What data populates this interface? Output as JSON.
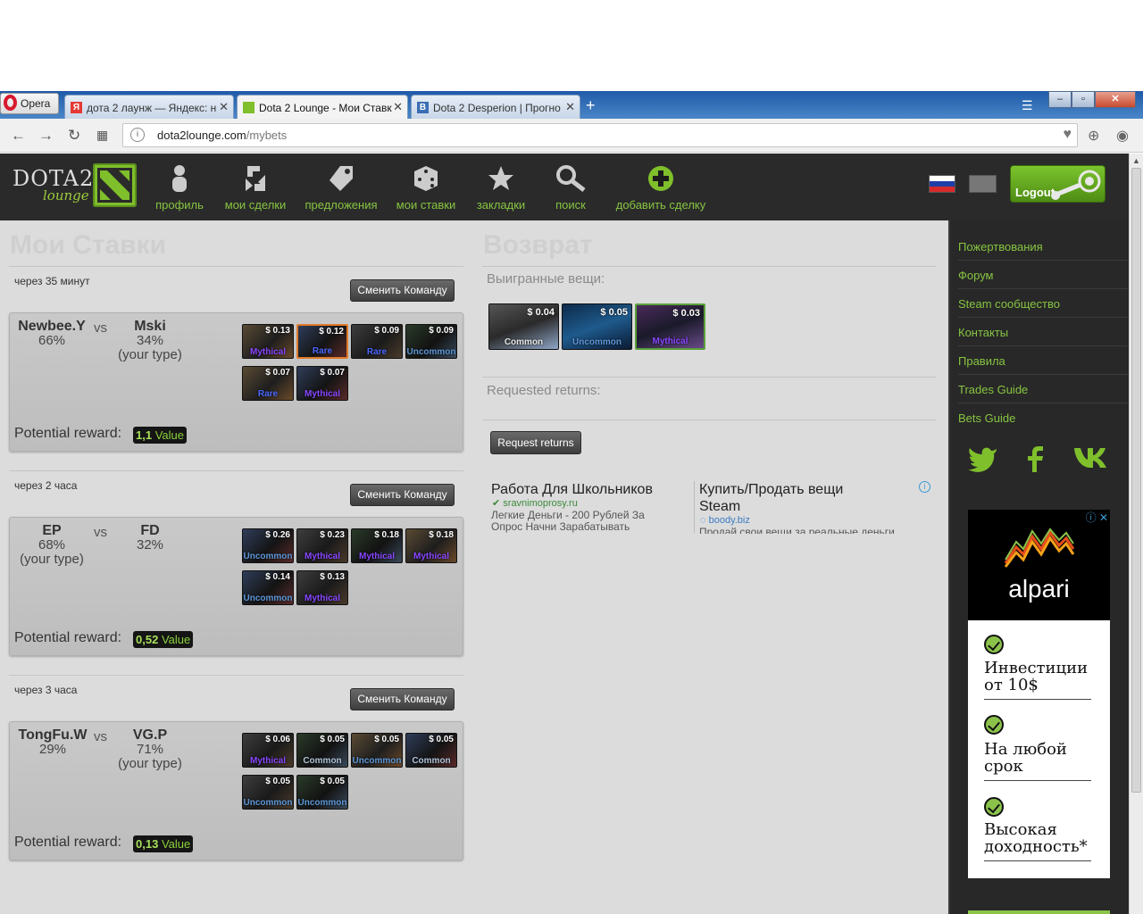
{
  "browser": {
    "opera_label": "Opera",
    "tabs": [
      {
        "title": "дота 2 лаунж — Яндекс: н",
        "fav": "Я",
        "favcolor": "#e53935"
      },
      {
        "title": "Dota 2 Lounge - Мои Ставк",
        "fav": "",
        "favcolor": "#7fbf2b"
      },
      {
        "title": "Dota 2 Desperion | Прогно",
        "fav": "B",
        "favcolor": "#3b6db3"
      }
    ],
    "url_host": "dota2lounge.com",
    "url_path": "/mybets"
  },
  "header": {
    "logo_main": "DOTA2",
    "logo_sub": "lounge",
    "nav": [
      {
        "label": "профиль",
        "icon": "person-icon"
      },
      {
        "label": "мои сделки",
        "icon": "trades-icon"
      },
      {
        "label": "предложения",
        "icon": "tag-icon"
      },
      {
        "label": "мои ставки",
        "icon": "dice-icon"
      },
      {
        "label": "закладки",
        "icon": "star-icon"
      },
      {
        "label": "поиск",
        "icon": "search-icon"
      },
      {
        "label": "добавить сделку",
        "icon": "plus-circle-icon"
      }
    ],
    "logout_label": "Logout"
  },
  "bets": {
    "title": "Мои Ставки",
    "change_team_label": "Сменить Команду",
    "reward_label": "Potential reward:",
    "reward_unit": "Value",
    "matches": [
      {
        "timer": "через 35 минут",
        "team1": {
          "name": "Newbee.Y",
          "pct": "66%",
          "note": ""
        },
        "team2": {
          "name": "Mski",
          "pct": "34%",
          "note": "(your type)"
        },
        "vs": "vs",
        "reward": "1,1",
        "items": [
          {
            "price": "$ 0.13",
            "rarity": "Mythical"
          },
          {
            "price": "$ 0.12",
            "rarity": "Rare"
          },
          {
            "price": "$ 0.09",
            "rarity": "Rare"
          },
          {
            "price": "$ 0.09",
            "rarity": "Uncommon"
          },
          {
            "price": "$ 0.07",
            "rarity": "Rare"
          },
          {
            "price": "$ 0.07",
            "rarity": "Mythical"
          }
        ]
      },
      {
        "timer": "через 2 часа",
        "team1": {
          "name": "EP",
          "pct": "68%",
          "note": "(your type)"
        },
        "team2": {
          "name": "FD",
          "pct": "32%",
          "note": ""
        },
        "vs": "vs",
        "reward": "0,52",
        "items": [
          {
            "price": "$ 0.26",
            "rarity": "Uncommon"
          },
          {
            "price": "$ 0.23",
            "rarity": "Mythical"
          },
          {
            "price": "$ 0.18",
            "rarity": "Mythical"
          },
          {
            "price": "$ 0.18",
            "rarity": "Mythical"
          },
          {
            "price": "$ 0.14",
            "rarity": "Uncommon"
          },
          {
            "price": "$ 0.13",
            "rarity": "Mythical"
          }
        ]
      },
      {
        "timer": "через 3 часа",
        "team1": {
          "name": "TongFu.W",
          "pct": "29%",
          "note": ""
        },
        "team2": {
          "name": "VG.P",
          "pct": "71%",
          "note": "(your type)"
        },
        "vs": "vs",
        "reward": "0,13",
        "items": [
          {
            "price": "$ 0.06",
            "rarity": "Mythical"
          },
          {
            "price": "$ 0.05",
            "rarity": "Common"
          },
          {
            "price": "$ 0.05",
            "rarity": "Uncommon"
          },
          {
            "price": "$ 0.05",
            "rarity": "Common"
          },
          {
            "price": "$ 0.05",
            "rarity": "Uncommon"
          },
          {
            "price": "$ 0.05",
            "rarity": "Uncommon"
          }
        ]
      }
    ]
  },
  "returns": {
    "title": "Возврат",
    "won_label": "Выигранные вещи:",
    "won_items": [
      {
        "price": "$ 0.04",
        "rarity": "Common"
      },
      {
        "price": "$ 0.05",
        "rarity": "Uncommon"
      },
      {
        "price": "$ 0.03",
        "rarity": "Mythical"
      }
    ],
    "requested_label": "Requested returns:",
    "request_button": "Request returns"
  },
  "ad1": {
    "left_title": "Работа Для Школьников",
    "left_host": "sravnimoprosy.ru",
    "left_text_1": "Легкие Деньги - 200 Рублей За",
    "left_text_2": "Опрос Начни Зарабатывать",
    "right_title_1": "Купить/Продать вещи",
    "right_title_2": "Steam",
    "right_host": "boody.biz",
    "right_text": "Продай свои вещи за реальные деньги"
  },
  "sidebar": {
    "links": [
      "Пожертвования",
      "Форум",
      "Steam сообщество",
      "Контакты",
      "Правила",
      "Trades Guide",
      "Bets Guide"
    ],
    "ad": {
      "brand": "alpari",
      "rows": [
        "Инвестиции от 10$",
        "На любой срок",
        "Высокая доходность*"
      ]
    }
  },
  "colors": {
    "accent": "#86c440",
    "mythical": "#8847ff",
    "rare": "#4b69ff",
    "uncommon": "#5e98d9",
    "common": "#b0c3d9"
  }
}
